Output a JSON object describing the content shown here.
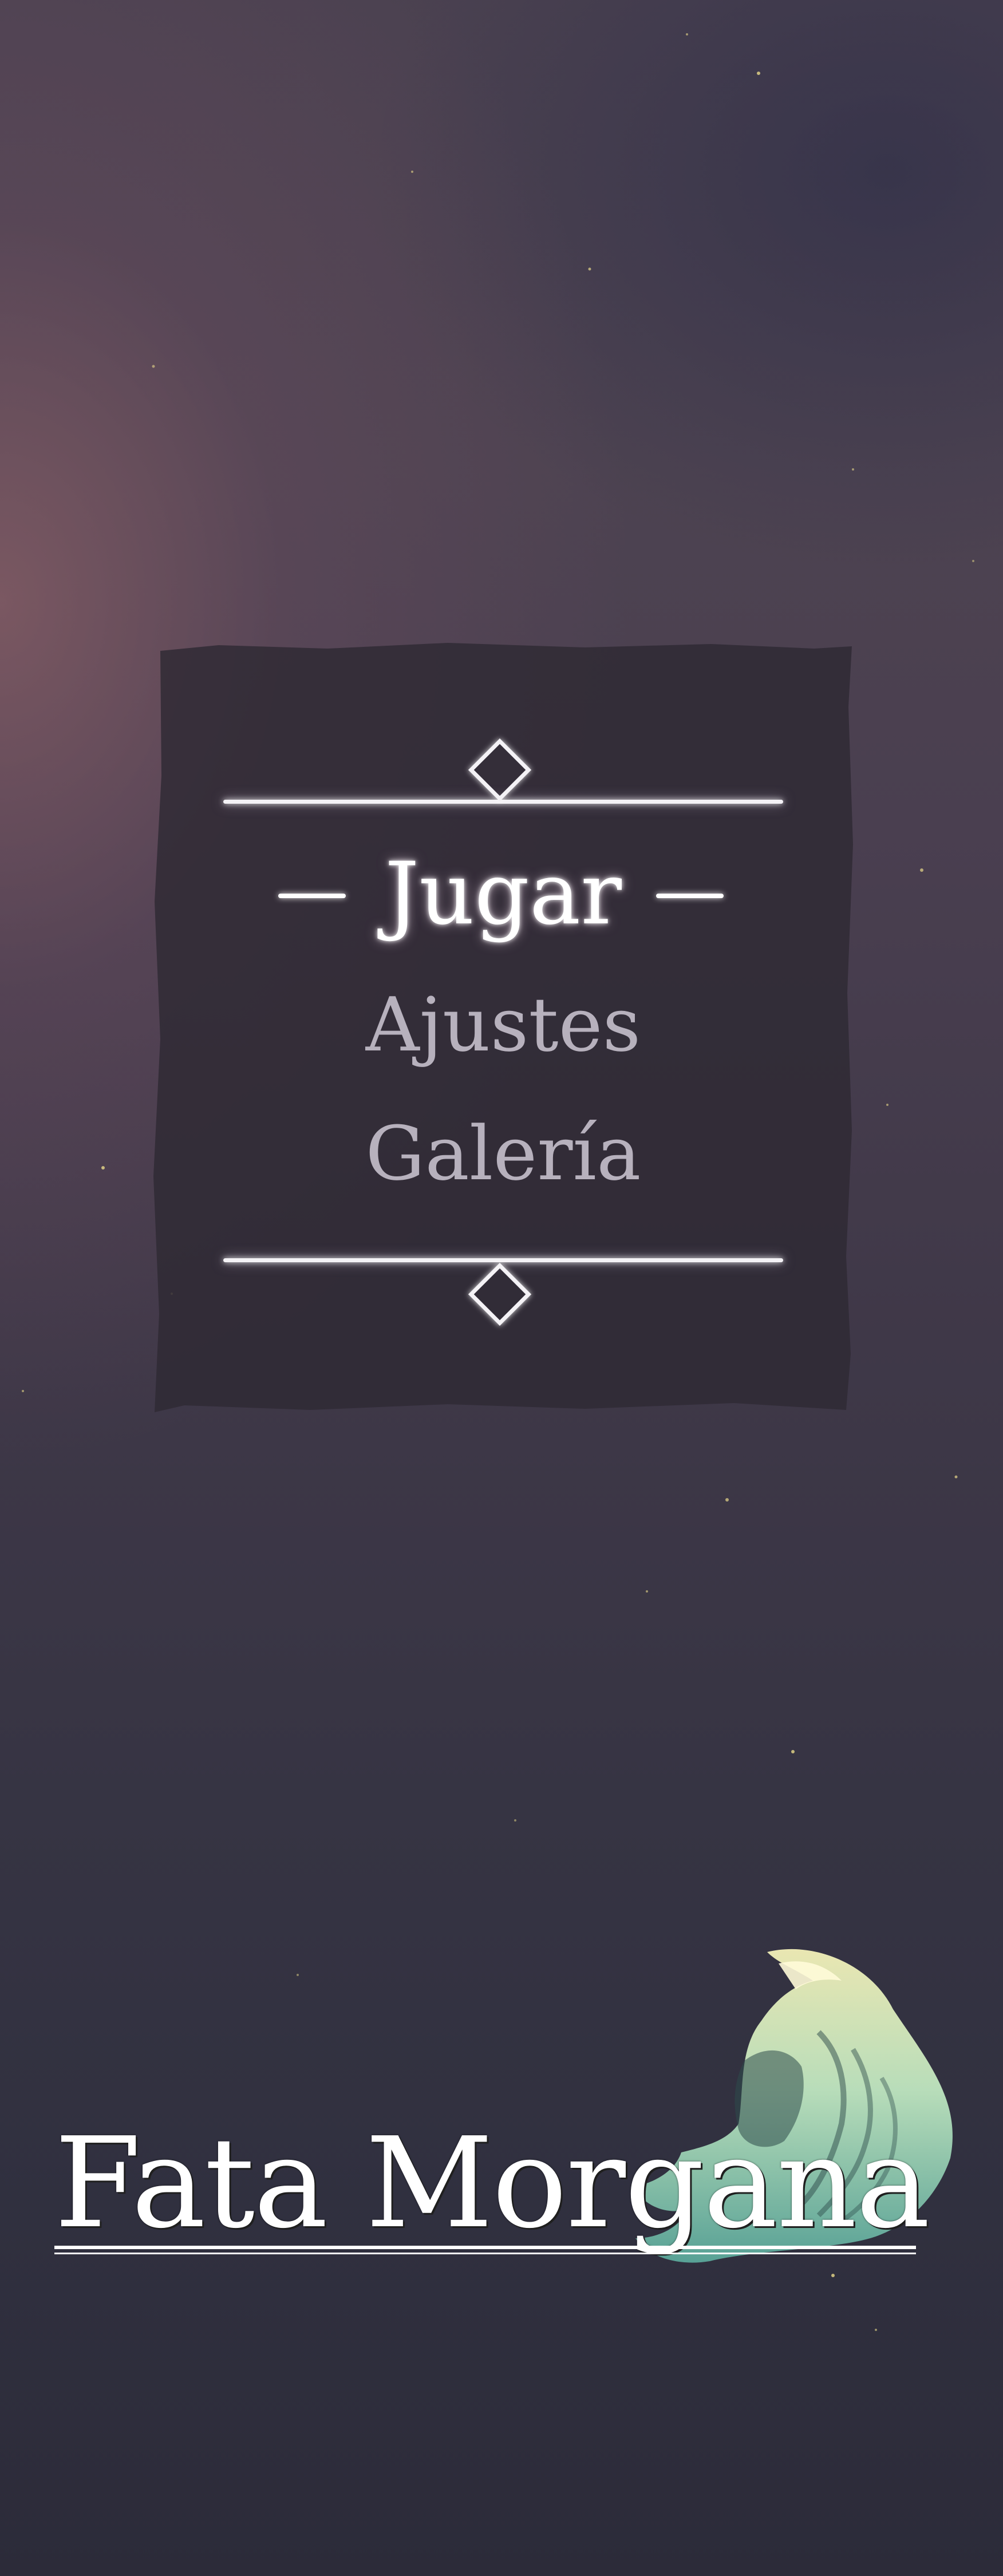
{
  "menu": {
    "items": [
      {
        "label": "Jugar",
        "selected": true
      },
      {
        "label": "Ajustes",
        "selected": false
      },
      {
        "label": "Galería",
        "selected": false
      }
    ]
  },
  "logo": {
    "title": "Fata Morgana"
  },
  "colors": {
    "selected_text": "#ffffff",
    "unselected_text": "#b7b1bd",
    "panel": "#2e2a33",
    "wave_light": "#f3f0b8",
    "wave_mid": "#a5dcc0",
    "wave_dark": "#5aa79a"
  },
  "icons": {
    "top_ornament": "diamond-icon",
    "bottom_ornament": "diamond-icon"
  }
}
